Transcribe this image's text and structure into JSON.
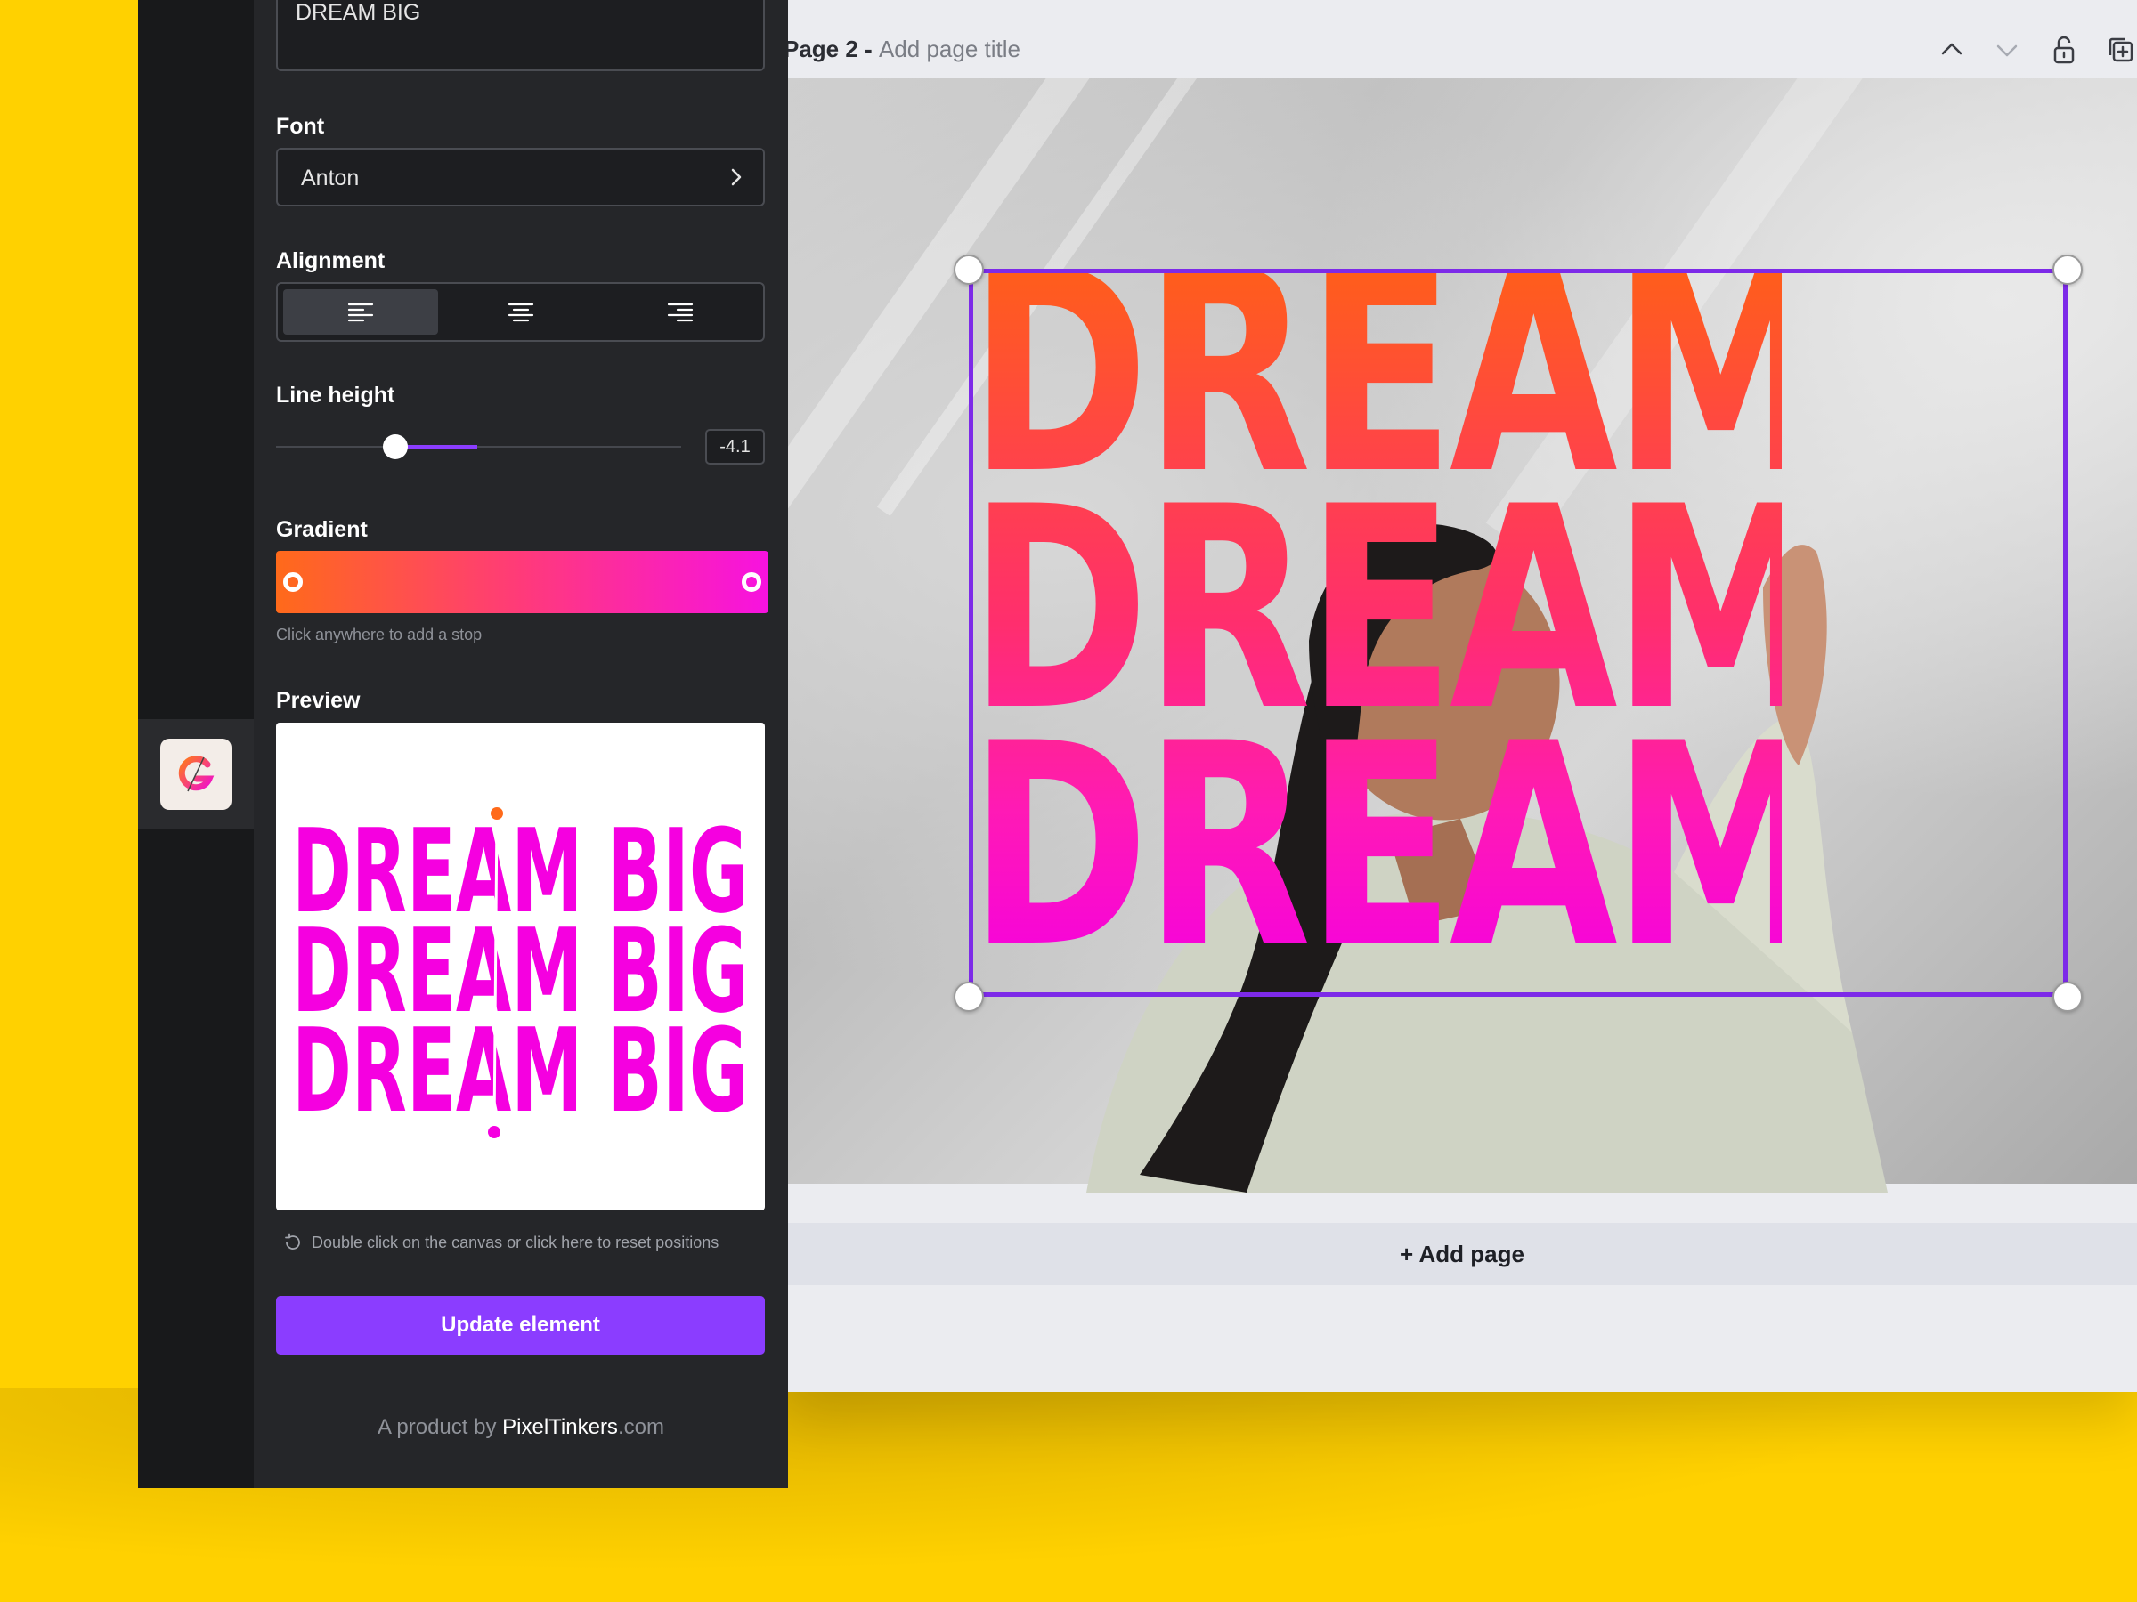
{
  "page_header": {
    "page_label": "Page 2 -",
    "title_placeholder": "Add page title"
  },
  "canvas": {
    "text_lines": [
      "DREAM BIG",
      "DREAM BIG",
      "DREAM BIG"
    ],
    "gradient_colors": [
      "#FF5E1A",
      "#FF2E6E",
      "#F500E0"
    ]
  },
  "add_page_label": "+ Add page",
  "panel": {
    "text_value": "DREAM BIG",
    "font_label": "Font",
    "font_value": "Anton",
    "alignment_label": "Alignment",
    "alignment_options": [
      "align-left",
      "align-center",
      "align-right"
    ],
    "alignment_selected": "align-left",
    "line_height_label": "Line height",
    "line_height_value": "-4.1",
    "gradient_label": "Gradient",
    "gradient_hint": "Click anywhere to add a stop",
    "gradient_stops": [
      "#FF6A1A",
      "#F712E0"
    ],
    "preview_label": "Preview",
    "preview_lines": [
      "DREAM BIG",
      "DREAM BIG",
      "DREAM BIG"
    ],
    "reset_hint": "Double click on the canvas or click here to reset positions",
    "update_button": "Update element",
    "footer_prefix": "A product by ",
    "footer_brand": "PixelTinkers",
    "footer_suffix": ".com"
  },
  "accent_color": "#8B3DFF"
}
